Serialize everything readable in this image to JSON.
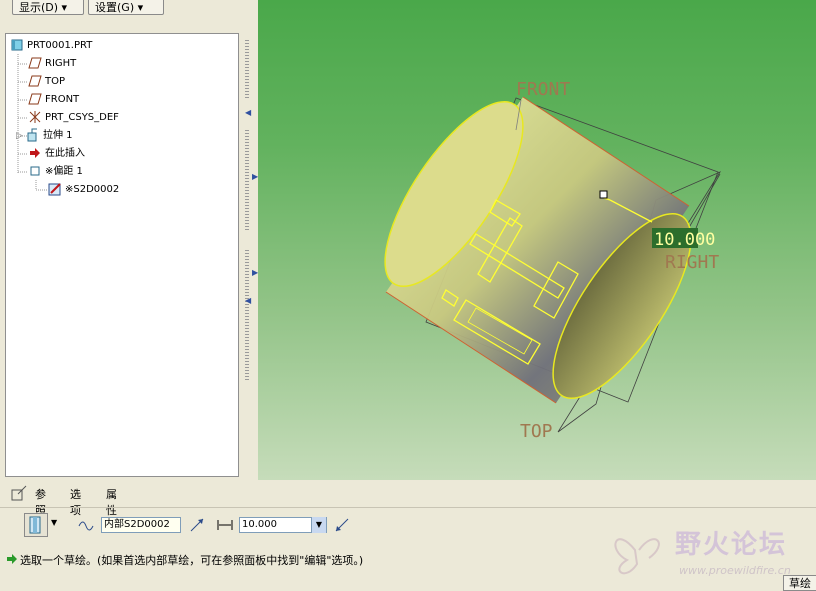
{
  "menu": {
    "display_label": "显示(D) ▾",
    "settings_label": "设置(G) ▾"
  },
  "tree": {
    "root": "PRT0001.PRT",
    "items": [
      {
        "label": "RIGHT"
      },
      {
        "label": "TOP"
      },
      {
        "label": "FRONT"
      },
      {
        "label": "PRT_CSYS_DEF"
      },
      {
        "label": "拉伸 1"
      },
      {
        "label": "在此插入"
      },
      {
        "label": "※偏距 1"
      },
      {
        "label": "※S2D0002"
      }
    ]
  },
  "viewport": {
    "front_label": "FRONT",
    "right_label": "RIGHT",
    "top_label": "TOP",
    "dimension_value": "10.000"
  },
  "dashboard": {
    "tabs": [
      "参照",
      "选项",
      "属性"
    ],
    "sketch_field": "内部S2D0002",
    "depth_value": "10.000"
  },
  "status": {
    "message": "选取一个草绘。(如果首选内部草绘，可在参照面板中找到\"编辑\"选项。)",
    "sketch_button": "草绘"
  },
  "watermark": {
    "text": "野火论坛",
    "url": "www.proewildfire.cn"
  },
  "colors": {
    "viewport_top": "#4aa84a",
    "viewport_bottom": "#c6dcba",
    "highlight": "#ffff33",
    "dimension_bg": "#2c6e2c"
  }
}
